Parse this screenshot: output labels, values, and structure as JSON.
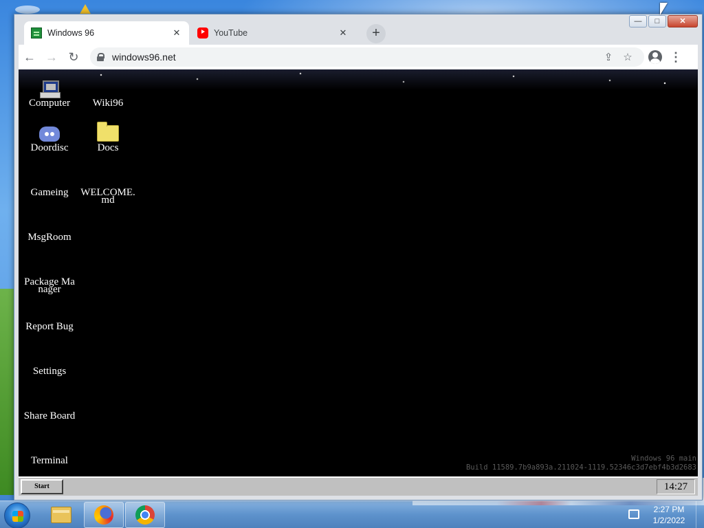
{
  "browser": {
    "tabs": [
      {
        "title": "Windows 96",
        "favicon": "windows96-favicon"
      },
      {
        "title": "YouTube",
        "favicon": "youtube-favicon"
      }
    ],
    "url": "windows96.net",
    "window_controls": {
      "minimize": "—",
      "maximize": "□",
      "close": "✕"
    }
  },
  "desktop": {
    "icons": [
      {
        "label": "Computer",
        "icon": "computer-icon"
      },
      {
        "label": "Wiki96",
        "icon": ""
      },
      {
        "label": "Doordisc",
        "icon": "discord-icon"
      },
      {
        "label": "Docs",
        "icon": "folder-icon"
      },
      {
        "label": "Gameing",
        "icon": ""
      },
      {
        "label": "WELCOME.md",
        "icon": ""
      },
      {
        "label": "MsgRoom",
        "icon": ""
      },
      {
        "label": "Package Manager",
        "icon": ""
      },
      {
        "label": "Report Bug",
        "icon": ""
      },
      {
        "label": "Settings",
        "icon": ""
      },
      {
        "label": "Share Board",
        "icon": ""
      },
      {
        "label": "Terminal",
        "icon": ""
      }
    ],
    "build_info": {
      "line1": "Windows 96 main",
      "line2": "Build 11589.7b9a893a.211024-1119.52346c3d7ebf4b3d2683"
    }
  },
  "w96_taskbar": {
    "start_label": "Start",
    "clock": "14:27"
  },
  "os_taskbar": {
    "pinned": [
      {
        "name": "File Explorer",
        "icon": "folder-icon",
        "running": false
      },
      {
        "name": "Firefox",
        "icon": "firefox-icon",
        "running": true
      },
      {
        "name": "Google Chrome",
        "icon": "chrome-icon",
        "running": true
      }
    ],
    "time": "2:27 PM",
    "date": "1/2/2022"
  },
  "colors": {
    "w96_background": "#000000",
    "w96_taskbar": "#c0c0c0",
    "browser_frame": "#dee1e6"
  }
}
